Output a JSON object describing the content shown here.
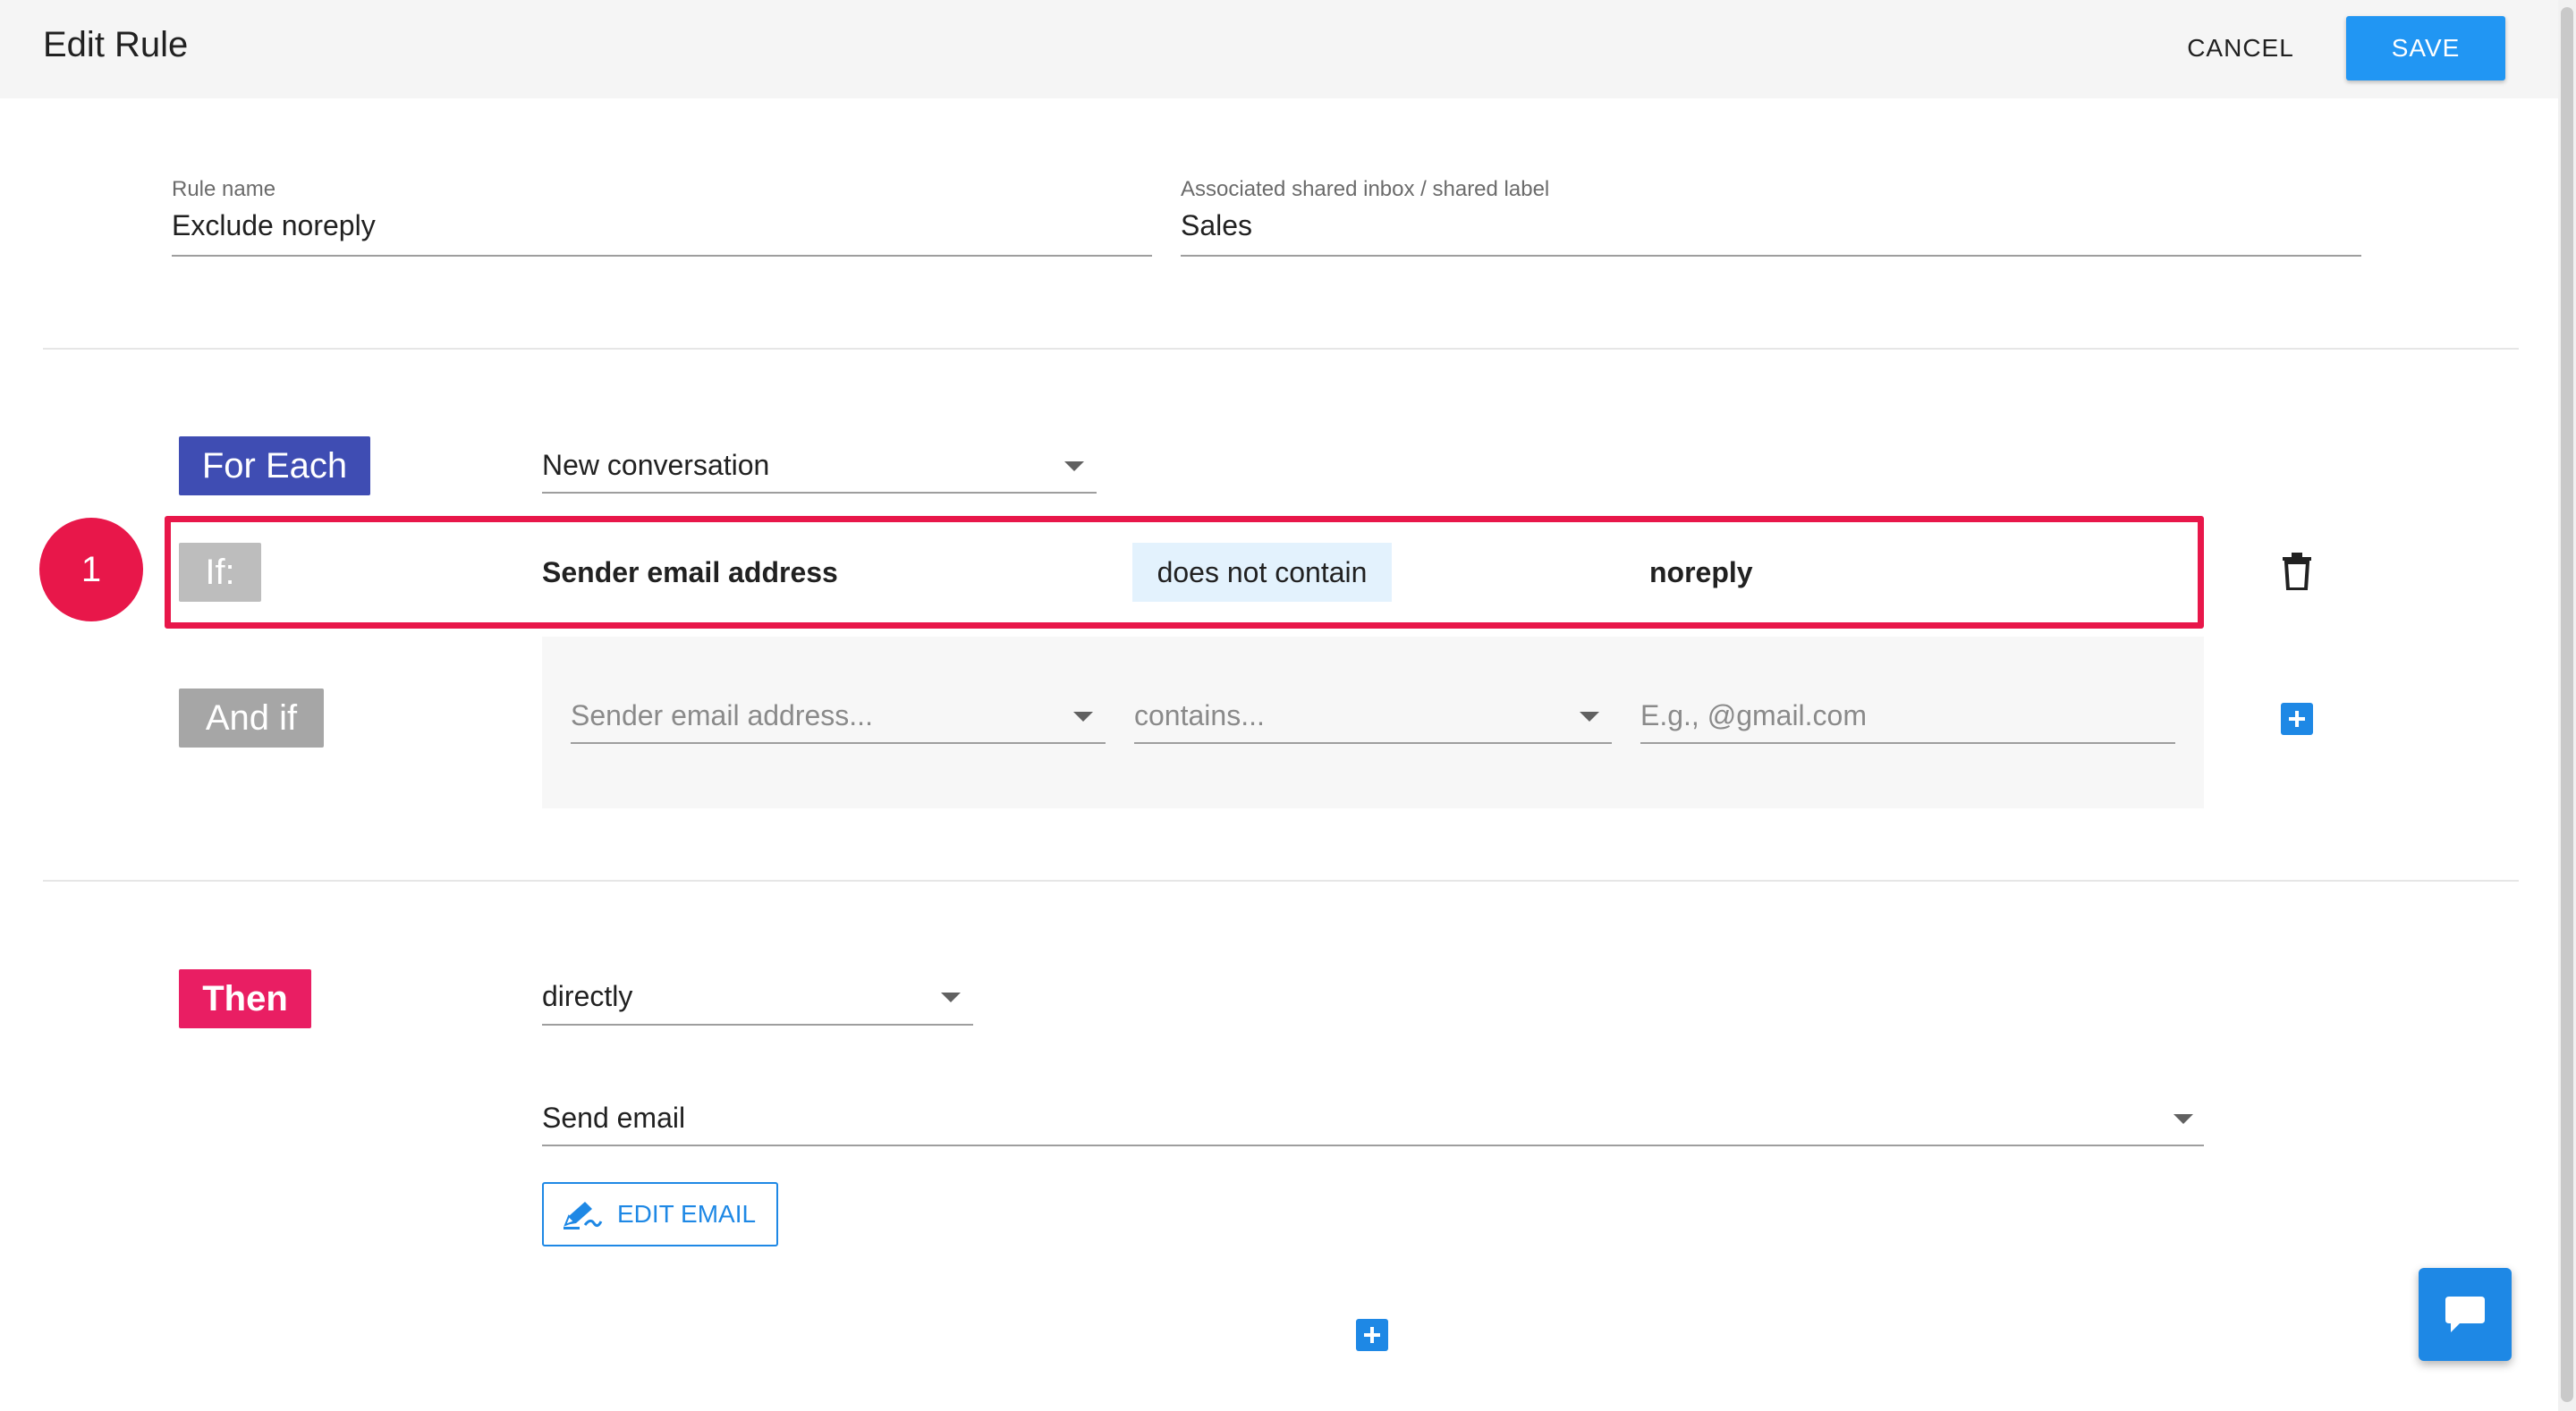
{
  "header": {
    "title": "Edit Rule",
    "cancel_label": "CANCEL",
    "save_label": "SAVE"
  },
  "rule_name": {
    "label": "Rule name",
    "value": "Exclude noreply"
  },
  "inbox": {
    "label": "Associated shared inbox / shared label",
    "value": "Sales"
  },
  "for_each": {
    "chip": "For Each",
    "selected": "New conversation"
  },
  "if_condition": {
    "step_number": "1",
    "chip": "If:",
    "field": "Sender email address",
    "operator": "does not contain",
    "value": "noreply"
  },
  "and_if": {
    "chip": "And if",
    "field_placeholder": "Sender email address...",
    "operator_placeholder": "contains...",
    "value_placeholder": "E.g., @gmail.com"
  },
  "then": {
    "chip": "Then",
    "timing": "directly",
    "action": "Send email",
    "edit_email_label": "EDIT EMAIL"
  },
  "icons": {
    "delete": "trash-icon",
    "add": "plus-icon",
    "edit": "pencil-icon",
    "chat": "chat-bubble-icon"
  },
  "colors": {
    "accent": "#2196f3",
    "for_each": "#3f4db3",
    "then": "#e91e63",
    "highlight": "#e8174a",
    "chip_gray": "#a6a6a6"
  }
}
